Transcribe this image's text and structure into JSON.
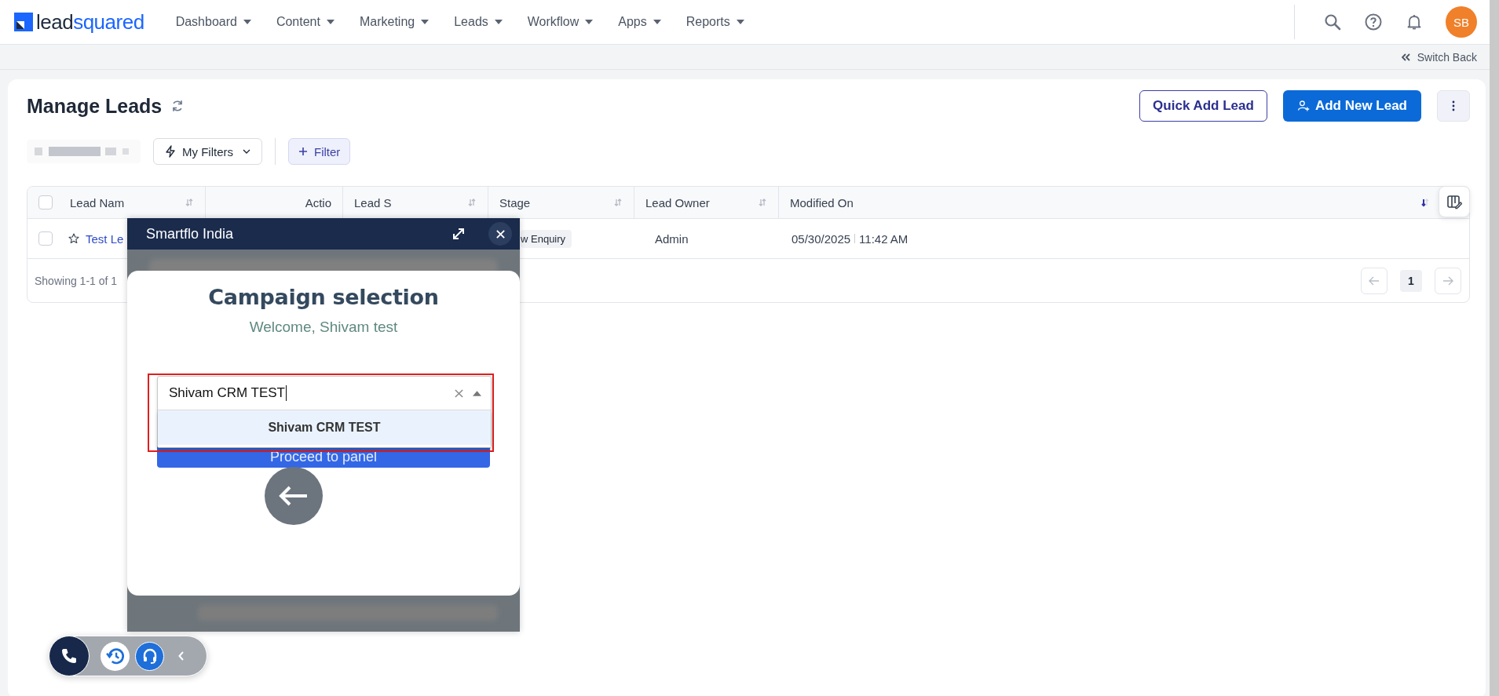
{
  "nav": {
    "logo": {
      "first": "lead",
      "second": "squared"
    },
    "menus": [
      {
        "label": "Dashboard"
      },
      {
        "label": "Content"
      },
      {
        "label": "Marketing"
      },
      {
        "label": "Leads"
      },
      {
        "label": "Workflow"
      },
      {
        "label": "Apps"
      },
      {
        "label": "Reports"
      }
    ],
    "avatar": "SB"
  },
  "switch_back": "Switch Back",
  "page": {
    "title": "Manage Leads",
    "quick_add": "Quick Add Lead",
    "add_new": "Add New Lead"
  },
  "filters": {
    "my_filters": "My Filters",
    "filter": "Filter"
  },
  "table": {
    "select_all_checked": false,
    "columns": [
      {
        "label": "Lead Nam",
        "sortable": true,
        "sorted": false
      },
      {
        "label": "Actio",
        "sortable": false
      },
      {
        "label": "Lead S",
        "sortable": true,
        "sorted": false
      },
      {
        "label": "Stage",
        "sortable": true,
        "sorted": false
      },
      {
        "label": "Lead Owner",
        "sortable": true,
        "sorted": false
      },
      {
        "label": "Modified On",
        "sortable": true,
        "sorted": true
      }
    ],
    "rows": [
      {
        "checked": false,
        "lead_name": "Test Le",
        "stage": "w Enquiry",
        "lead_owner": "Admin",
        "date": "05/30/2025",
        "time": "11:42 AM"
      }
    ],
    "showing": "Showing 1-1 of 1",
    "page": "1"
  },
  "dialer": {
    "title": "Smartflo India",
    "heading": "Campaign selection",
    "welcome": "Welcome, Shivam test",
    "campaign_input": {
      "value": "Shivam CRM TEST"
    },
    "options": [
      {
        "label": "Shivam CRM TEST",
        "selected": true
      }
    ],
    "proceed": "Proceed to panel"
  }
}
